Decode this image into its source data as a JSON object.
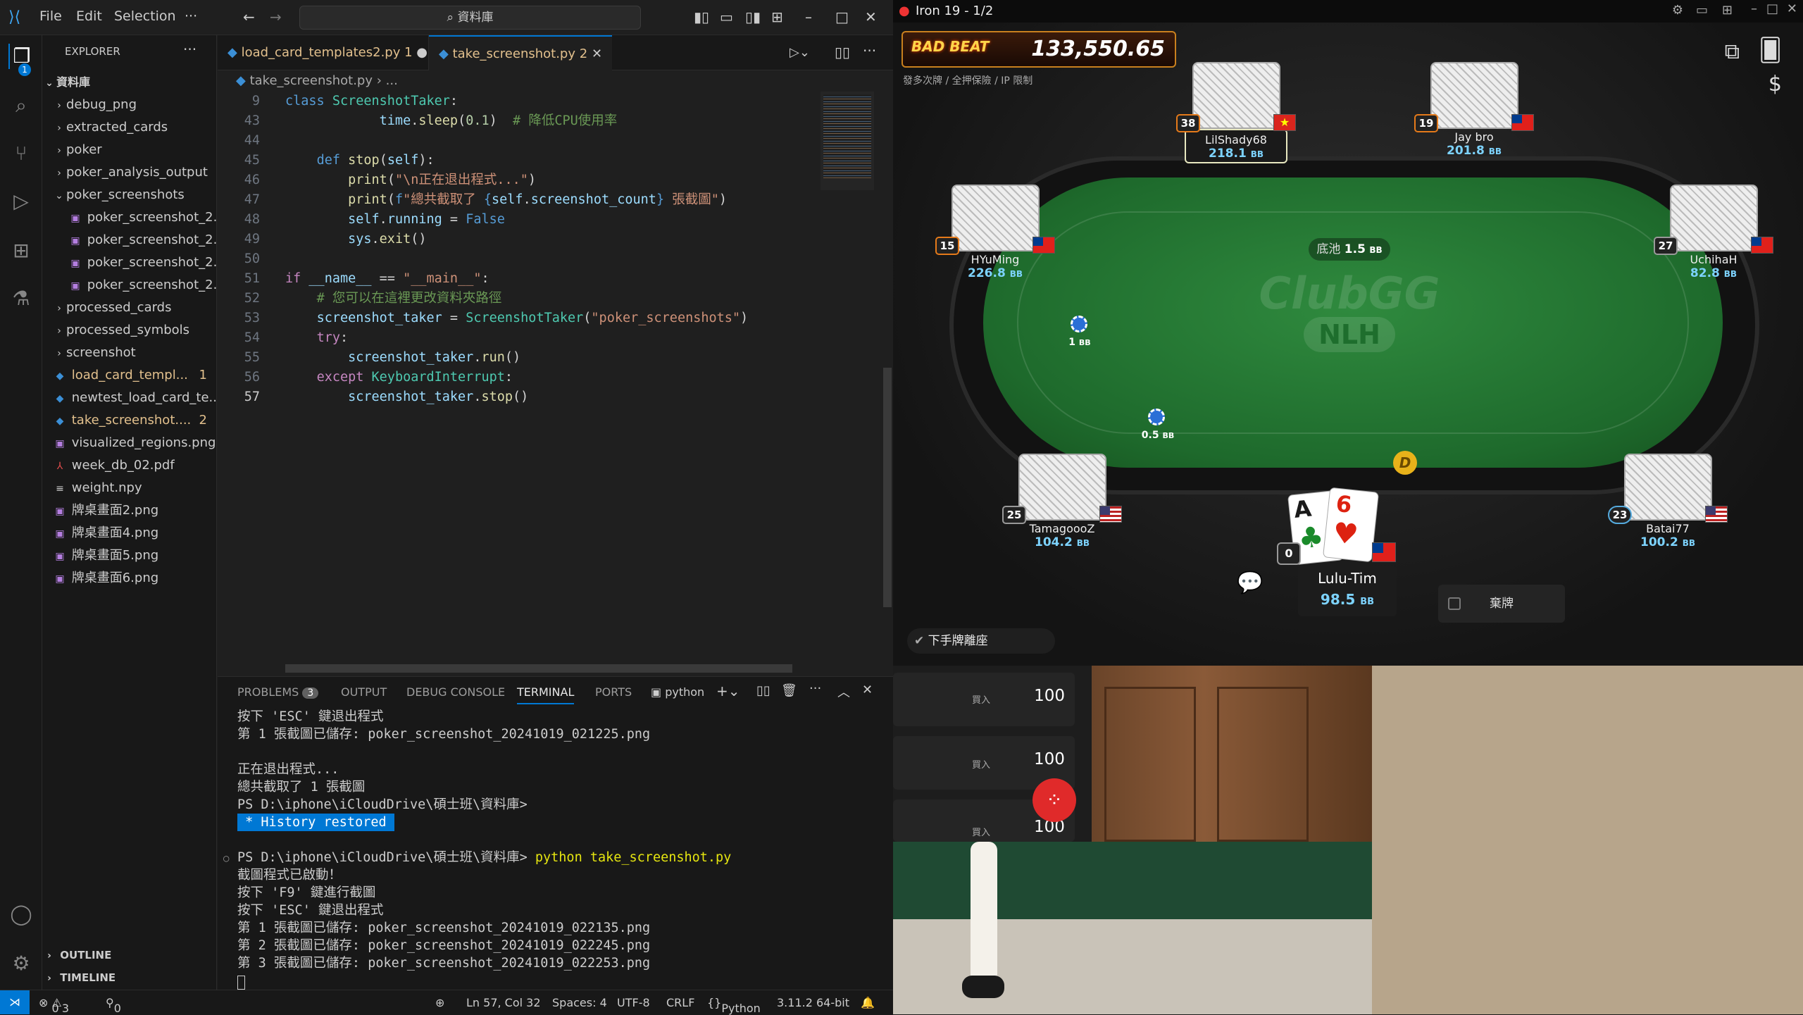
{
  "titlebar": {
    "menus": [
      "File",
      "Edit",
      "Selection",
      "···"
    ],
    "search": "資料庫"
  },
  "sidebar": {
    "header": "EXPLORER",
    "root": "資料庫",
    "items": [
      {
        "label": "debug_png",
        "type": "folder",
        "open": false
      },
      {
        "label": "extracted_cards",
        "type": "folder",
        "open": false
      },
      {
        "label": "poker",
        "type": "folder",
        "open": false
      },
      {
        "label": "poker_analysis_output",
        "type": "folder",
        "open": false
      },
      {
        "label": "poker_screenshots",
        "type": "folder",
        "open": true
      },
      {
        "label": "poker_screenshot_2...",
        "type": "image",
        "indent": true
      },
      {
        "label": "poker_screenshot_2...",
        "type": "image",
        "indent": true
      },
      {
        "label": "poker_screenshot_2...",
        "type": "image",
        "indent": true
      },
      {
        "label": "poker_screenshot_2...",
        "type": "image",
        "indent": true
      },
      {
        "label": "processed_cards",
        "type": "folder",
        "open": false
      },
      {
        "label": "processed_symbols",
        "type": "folder",
        "open": false
      },
      {
        "label": "screenshot",
        "type": "folder",
        "open": false
      },
      {
        "label": "load_card_templ...",
        "type": "py",
        "badge": "1",
        "color": "#e2c08d"
      },
      {
        "label": "newtest_load_card_te...",
        "type": "py"
      },
      {
        "label": "take_screenshot....",
        "type": "py",
        "badge": "2",
        "color": "#e2c08d"
      },
      {
        "label": "visualized_regions.png",
        "type": "image"
      },
      {
        "label": "week_db_02.pdf",
        "type": "pdf"
      },
      {
        "label": "weight.npy",
        "type": "file"
      },
      {
        "label": "牌桌畫面2.png",
        "type": "image"
      },
      {
        "label": "牌桌畫面4.png",
        "type": "image"
      },
      {
        "label": "牌桌畫面5.png",
        "type": "image"
      },
      {
        "label": "牌桌畫面6.png",
        "type": "image"
      }
    ],
    "outline": "OUTLINE",
    "timeline": "TIMELINE"
  },
  "editor": {
    "tabs": [
      {
        "label": "load_card_templates2.py",
        "badge": "1",
        "dirty": true
      },
      {
        "label": "take_screenshot.py",
        "badge": "2",
        "active": true
      }
    ],
    "breadcrumb": [
      "take_screenshot.py",
      "..."
    ],
    "lines": [
      {
        "n": "9",
        "html": "<span class='kw'>class</span> <span class='cls'>ScreenshotTaker</span><span class='wht'>:</span>"
      },
      {
        "n": "43",
        "html": "            <span class='var'>time</span><span class='wht'>.</span><span class='fn'>sleep</span><span class='wht'>(</span><span class='num'>0.1</span><span class='wht'>)  </span><span class='cmt'># 降低CPU使用率</span>"
      },
      {
        "n": "44",
        "html": ""
      },
      {
        "n": "45",
        "html": "    <span class='kw'>def</span> <span class='fn'>stop</span><span class='wht'>(</span><span class='var'>self</span><span class='wht'>):</span>"
      },
      {
        "n": "46",
        "html": "        <span class='fn'>print</span><span class='wht'>(</span><span class='str'>\"\\n正在退出程式...\"</span><span class='wht'>)</span>"
      },
      {
        "n": "47",
        "html": "        <span class='fn'>print</span><span class='wht'>(</span><span class='kw'>f</span><span class='str'>\"總共截取了 </span><span class='kw'>{</span><span class='var'>self</span><span class='wht'>.</span><span class='var'>screenshot_count</span><span class='kw'>}</span><span class='str'> 張截圖\"</span><span class='wht'>)</span>"
      },
      {
        "n": "48",
        "html": "        <span class='var'>self</span><span class='wht'>.</span><span class='var'>running</span> <span class='wht'>=</span> <span class='kw'>False</span>"
      },
      {
        "n": "49",
        "html": "        <span class='var'>sys</span><span class='wht'>.</span><span class='fn'>exit</span><span class='wht'>()</span>"
      },
      {
        "n": "50",
        "html": ""
      },
      {
        "n": "51",
        "html": "<span class='kw2'>if</span> <span class='var'>__name__</span> <span class='wht'>==</span> <span class='str'>\"__main__\"</span><span class='wht'>:</span>"
      },
      {
        "n": "52",
        "html": "    <span class='cmt'># 您可以在這裡更改資料夾路徑</span>"
      },
      {
        "n": "53",
        "html": "    <span class='var'>screenshot_taker</span> <span class='wht'>=</span> <span class='cls'>ScreenshotTaker</span><span class='wht'>(</span><span class='str'>\"poker_screenshots\"</span><span class='wht'>)</span>"
      },
      {
        "n": "54",
        "html": "    <span class='kw2'>try</span><span class='wht'>:</span>"
      },
      {
        "n": "55",
        "html": "        <span class='var'>screenshot_taker</span><span class='wht'>.</span><span class='fn'>run</span><span class='wht'>()</span>"
      },
      {
        "n": "56",
        "html": "    <span class='kw2'>except</span> <span class='cls'>KeyboardInterrupt</span><span class='wht'>:</span>"
      },
      {
        "n": "57",
        "html": "        <span class='var'>screenshot_taker</span><span class='wht'>.</span><span class='fn'>stop</span><span class='wht'>()</span>"
      }
    ]
  },
  "panel": {
    "tabs": [
      "PROBLEMS",
      "OUTPUT",
      "DEBUG CONSOLE",
      "TERMINAL",
      "PORTS"
    ],
    "problems_count": "3",
    "shell": "python",
    "terminal_lines": [
      "按下 'ESC' 鍵退出程式",
      "第 1 張截圖已儲存: poker_screenshot_20241019_021225.png",
      "",
      "正在退出程式...",
      "總共截取了 1 張截圖",
      "PS D:\\iphone\\iCloudDrive\\碩士班\\資料庫>",
      "HISTORY",
      "",
      "PROMPT",
      "截圖程式已啟動！",
      "按下 'F9' 鍵進行截圖",
      "按下 'ESC' 鍵退出程式",
      "第 1 張截圖已儲存: poker_screenshot_20241019_022135.png",
      "第 2 張截圖已儲存: poker_screenshot_20241019_022245.png",
      "第 3 張截圖已儲存: poker_screenshot_20241019_022253.png"
    ],
    "history_restored": " * History restored ",
    "prompt_path": "PS D:\\iphone\\iCloudDrive\\碩士班\\資料庫> ",
    "prompt_cmd": "python take_screenshot.py"
  },
  "status": {
    "errors": "0",
    "warnings": "3",
    "ports": "0",
    "position": "Ln 57, Col 32",
    "spaces": "Spaces: 4",
    "encoding": "UTF-8",
    "eol": "CRLF",
    "lang": "Python",
    "interpreter": "3.11.2 64-bit"
  },
  "poker": {
    "window_title": "Iron 19 - 1/2",
    "badbeat_logo": "BAD BEAT",
    "jackpot": "133,550.65",
    "subtitle": "發多次牌 / 全押保險 / IP 限制",
    "pot_label": "底池",
    "pot_value": "1.5",
    "bb_unit": "BB",
    "brand1": "ClubGG",
    "brand2": "NLH",
    "seats": [
      {
        "name": "LilShady68",
        "stack": "218.1",
        "level": "38",
        "flag": "vn"
      },
      {
        "name": "Jay bro",
        "stack": "201.8",
        "level": "19",
        "flag": "tw"
      },
      {
        "name": "HYuMing",
        "stack": "226.8",
        "level": "15",
        "flag": "tw"
      },
      {
        "name": "UchihaH",
        "stack": "82.8",
        "level": "27",
        "flag": "tw"
      },
      {
        "name": "TamagoooZ",
        "stack": "104.2",
        "level": "25",
        "flag": "us"
      },
      {
        "name": "Batai77",
        "stack": "100.2",
        "level": "23",
        "flag": "us"
      }
    ],
    "hero": {
      "name": "Lulu-Tim",
      "stack": "98.5",
      "level": "0",
      "card1": "A",
      "card2": "6"
    },
    "bet1": "1",
    "bet2": "0.5",
    "dealer": "D",
    "fold_label": "棄牌",
    "sitout_label": "下手牌離座",
    "buyin_label": "買入",
    "buyins": [
      "100",
      "100",
      "100"
    ]
  }
}
